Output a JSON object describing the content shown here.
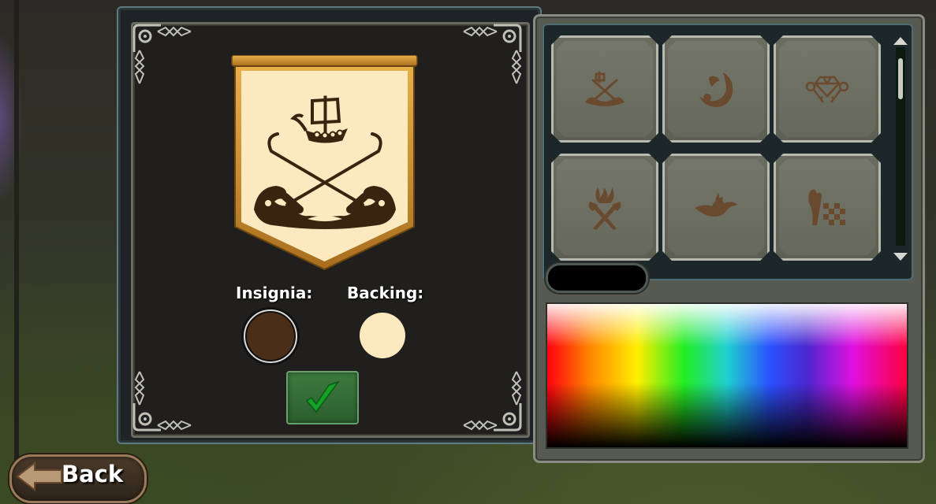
{
  "insignia_editor": {
    "insignia_label": "Insignia:",
    "backing_label": "Backing:",
    "insignia_color": "#4a2e18",
    "backing_color": "#fde9c0",
    "confirm_icon": "checkmark-icon"
  },
  "insignia_grid": {
    "tiles": [
      {
        "icon": "viking-ship-crossed-spears-icon"
      },
      {
        "icon": "dragon-crescent-icon"
      },
      {
        "icon": "gem-and-keys-icon"
      },
      {
        "icon": "flaming-axes-icon"
      },
      {
        "icon": "winged-dragon-icon"
      },
      {
        "icon": "checkered-flag-dragon-icon"
      }
    ]
  },
  "colors": {
    "panel_border": "#5f7b82",
    "confirm_green": "#3d7a3f",
    "icon_brown": "#6a4a2e"
  },
  "navigation": {
    "back_label": "Back"
  }
}
